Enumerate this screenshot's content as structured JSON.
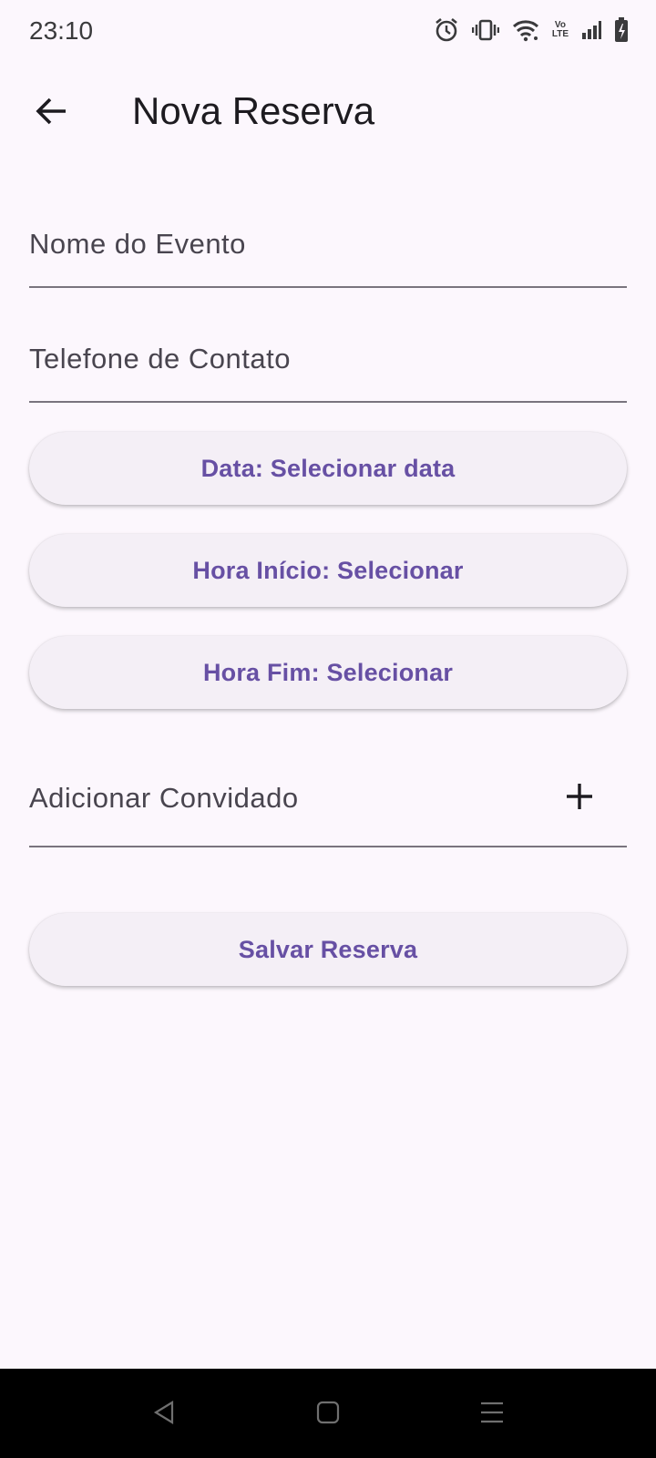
{
  "status_bar": {
    "time": "23:10",
    "icons": [
      "alarm-icon",
      "vibrate-icon",
      "wifi-icon",
      "volte-icon",
      "signal-icon",
      "battery-charging-icon"
    ],
    "volte_top": "Vo",
    "volte_bottom": "LTE"
  },
  "app_bar": {
    "title": "Nova Reserva",
    "back_icon": "arrow-back-icon"
  },
  "form": {
    "event_name_placeholder": "Nome do Evento",
    "phone_placeholder": "Telefone de Contato",
    "date_button": "Data: Selecionar data",
    "start_time_button": "Hora Início: Selecionar",
    "end_time_button": "Hora Fim: Selecionar",
    "add_guest_placeholder": "Adicionar Convidado",
    "add_guest_icon": "plus-icon",
    "save_button": "Salvar Reserva"
  },
  "nav_bar": {
    "back": "triangle-back-icon",
    "home": "square-home-icon",
    "recents": "menu-recents-icon"
  },
  "colors": {
    "background": "#fcf7fd",
    "accent": "#6750a4",
    "button_bg": "#f4eff6",
    "underline": "#79747e"
  }
}
